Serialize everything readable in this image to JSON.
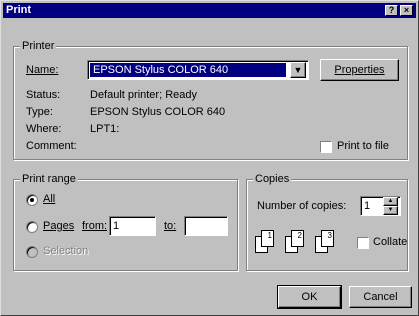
{
  "window": {
    "title": "Print",
    "help_button": "?",
    "close_button": "×"
  },
  "printer": {
    "group_label": "Printer",
    "name_label": "Name:",
    "name_value": "EPSON Stylus COLOR 640",
    "properties_label": "Properties",
    "status_label": "Status:",
    "status_value": "Default printer; Ready",
    "type_label": "Type:",
    "type_value": "EPSON Stylus COLOR 640",
    "where_label": "Where:",
    "where_value": "LPT1:",
    "comment_label": "Comment:",
    "print_to_file_label": "Print to file"
  },
  "print_range": {
    "group_label": "Print range",
    "all_label": "All",
    "pages_label": "Pages",
    "from_label": "from:",
    "from_value": "1",
    "to_label": "to:",
    "to_value": "",
    "selection_label": "Selection"
  },
  "copies": {
    "group_label": "Copies",
    "number_label": "Number of copies:",
    "number_value": "1",
    "collate_label": "Collate",
    "page_icons": [
      "1",
      "1",
      "2",
      "2",
      "3",
      "3"
    ]
  },
  "buttons": {
    "ok": "OK",
    "cancel": "Cancel"
  }
}
